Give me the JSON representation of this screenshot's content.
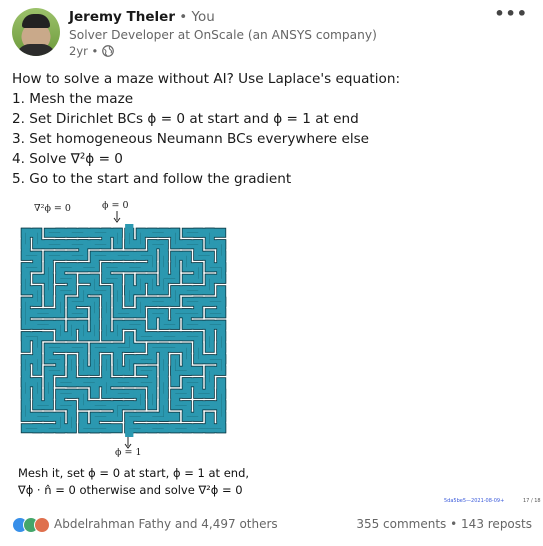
{
  "author": {
    "name": "Jeremy Theler",
    "you_tag": "• You",
    "headline": "Solver Developer at OnScale (an ANSYS company)",
    "age": "2yr •"
  },
  "post": {
    "lines": [
      "How to solve a maze without AI? Use Laplace's equation:",
      "1. Mesh the maze",
      "2. Set Dirichlet BCs ϕ = 0 at start and ϕ = 1 at end",
      "3. Set homogeneous Neumann BCs everywhere else",
      "4. Solve ∇²ϕ = 0",
      "5. Go to the start and follow the gradient"
    ]
  },
  "figure": {
    "label_laplace": "∇²ϕ = 0",
    "label_start": "ϕ = 0",
    "label_end": "ϕ = 1",
    "caption_line1": "Mesh it, set ϕ = 0 at start, ϕ = 1 at end,",
    "caption_line2": "∇ϕ · n̂ = 0 otherwise and solve ∇²ϕ = 0",
    "footnote": "5da5be5—2021-08-09+",
    "page": "17 / 18",
    "maze_fill": "#2b98b0",
    "maze_edge": "#0d3b47"
  },
  "social": {
    "reactions": "Abdelrahman Fathy and 4,497 others",
    "comments": "355 comments",
    "separator": "•",
    "reposts": "143 reposts",
    "icons": [
      "like-icon",
      "celebrate-icon",
      "love-icon"
    ]
  }
}
